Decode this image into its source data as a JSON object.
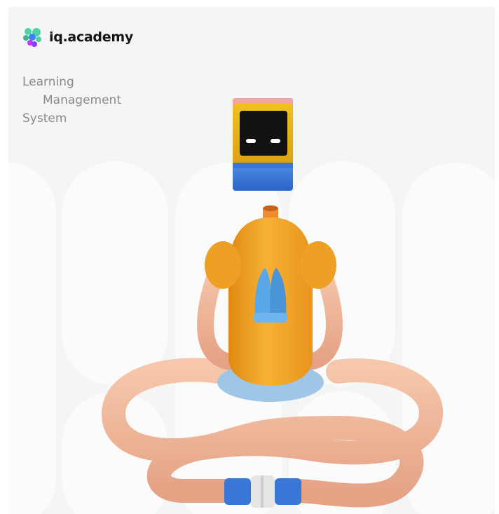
{
  "brand": {
    "name": "iq.academy",
    "logo_icon": "molecule-logo-icon",
    "colors": {
      "green": "#4fd1a5",
      "purple": "#8a3ffc",
      "blue": "#3b82f6",
      "magenta": "#c039e6"
    }
  },
  "tagline": {
    "line1": "Learning",
    "line2": "Management",
    "line3": "System"
  },
  "illustration": {
    "name": "meditating-robot-illustration",
    "colors": {
      "body": "#f5a623",
      "limbs": "#f0b89a",
      "gloves": "#5aa7e8",
      "head_frame": "#e8b81a",
      "screen": "#121212",
      "eyes": "#ffffff",
      "base": "#3a78d8"
    }
  }
}
